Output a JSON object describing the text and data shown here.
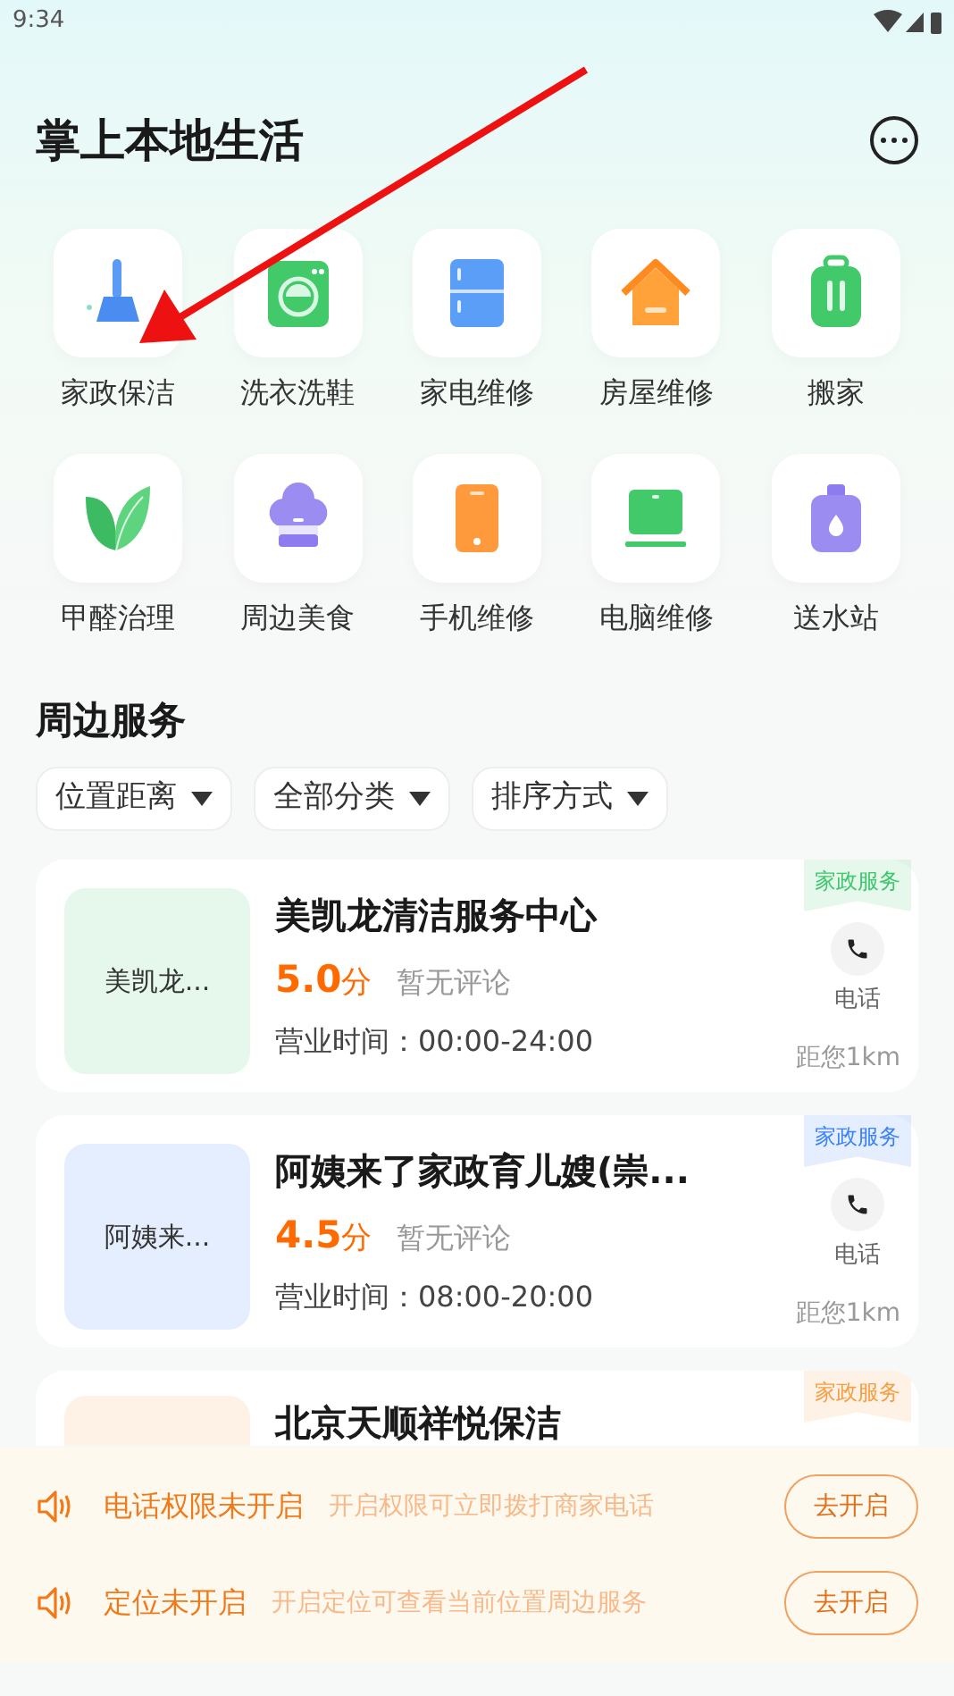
{
  "status_bar": {
    "time": "9:34"
  },
  "header": {
    "title": "掌上本地生活"
  },
  "categories": [
    {
      "label": "家政保洁",
      "kind": "broom"
    },
    {
      "label": "洗衣洗鞋",
      "kind": "washer"
    },
    {
      "label": "家电维修",
      "kind": "fridge"
    },
    {
      "label": "房屋维修",
      "kind": "house"
    },
    {
      "label": "搬家",
      "kind": "suitcase"
    },
    {
      "label": "甲醛治理",
      "kind": "leaf"
    },
    {
      "label": "周边美食",
      "kind": "chef"
    },
    {
      "label": "手机维修",
      "kind": "phone"
    },
    {
      "label": "电脑维修",
      "kind": "laptop"
    },
    {
      "label": "送水站",
      "kind": "bottle"
    }
  ],
  "section": {
    "title": "周边服务"
  },
  "filters": [
    "位置距离",
    "全部分类",
    "排序方式"
  ],
  "shops": [
    {
      "thumb": "美凯龙...",
      "name": "美凯龙清洁服务中心",
      "score": "5.0",
      "score_unit": "分",
      "reviews": "暂无评论",
      "hours": "营业时间：00:00-24:00",
      "tag": "家政服务",
      "color": "#3cc76a",
      "call": "电话",
      "distance": "距您1km"
    },
    {
      "thumb": "阿姨来...",
      "name": "阿姨来了家政育儿嫂(崇...",
      "score": "4.5",
      "score_unit": "分",
      "reviews": "暂无评论",
      "hours": "营业时间：08:00-20:00",
      "tag": "家政服务",
      "color": "#3b82f6",
      "call": "电话",
      "distance": "距您1km"
    },
    {
      "name": "北京天顺祥悦保洁",
      "tag": "家政服务",
      "color": "#f59e42"
    }
  ],
  "notices": [
    {
      "title": "电话权限未开启",
      "text": "开启权限可立即拨打商家电话",
      "button": "去开启"
    },
    {
      "title": "定位未开启",
      "text": "开启定位可查看当前位置周边服务",
      "button": "去开启"
    }
  ]
}
